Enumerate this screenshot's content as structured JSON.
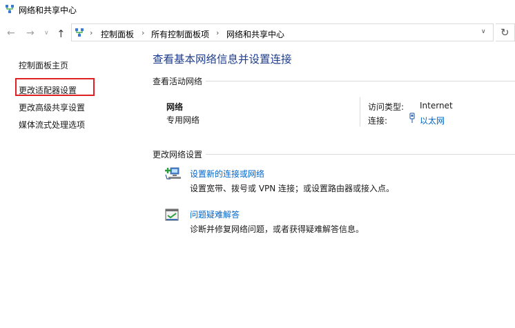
{
  "window": {
    "title": "网络和共享中心"
  },
  "nav": {
    "breadcrumbs": [
      "控制面板",
      "所有控制面板项",
      "网络和共享中心"
    ]
  },
  "sidebar": {
    "items": [
      {
        "label": "控制面板主页"
      },
      {
        "label": "更改适配器设置"
      },
      {
        "label": "更改高级共享设置"
      },
      {
        "label": "媒体流式处理选项"
      }
    ],
    "highlight_color": "#e02020"
  },
  "main": {
    "title": "查看基本网络信息并设置连接",
    "active_networks": {
      "header": "查看活动网络",
      "network_name": "网络",
      "network_type": "专用网络",
      "access_type_label": "访问类型:",
      "access_type_value": "Internet",
      "connection_label": "连接:",
      "connection_value": "以太网"
    },
    "change_settings": {
      "header": "更改网络设置",
      "tasks": [
        {
          "title": "设置新的连接或网络",
          "description": "设置宽带、拨号或 VPN 连接；或设置路由器或接入点。",
          "icon": "new-connection-icon"
        },
        {
          "title": "问题疑难解答",
          "description": "诊断并修复网络问题，或者获得疑难解答信息。",
          "icon": "troubleshoot-icon"
        }
      ]
    }
  },
  "colors": {
    "title": "#1e3d8c",
    "link": "#0066cc"
  }
}
